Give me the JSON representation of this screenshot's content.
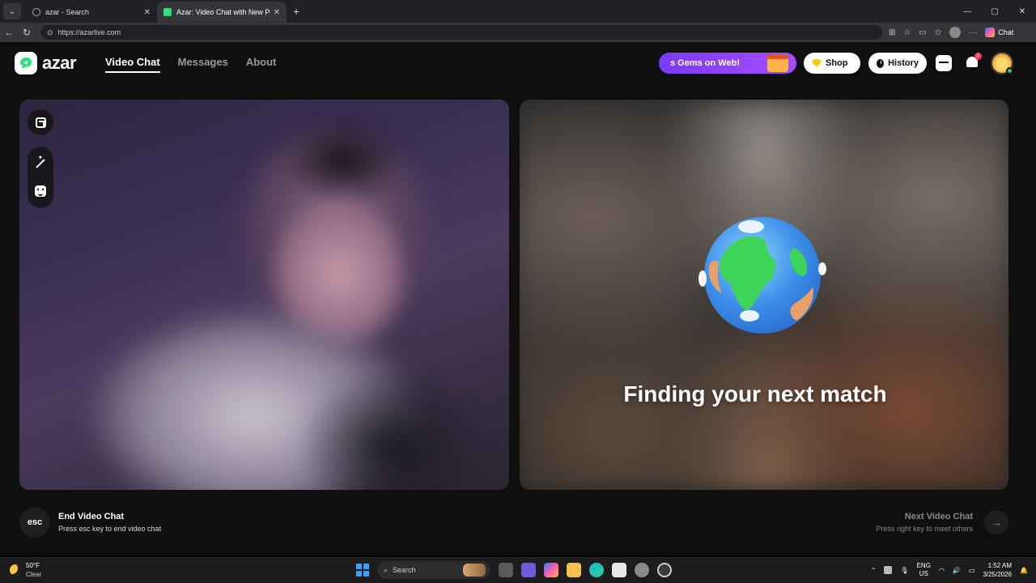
{
  "browser": {
    "tabs": [
      {
        "title": "azar - Search",
        "active": false
      },
      {
        "title": "Azar: Video Chat with New Pe",
        "active": true
      }
    ],
    "url": "https://azarlive.com",
    "chat_label": "Chat",
    "window_controls": {
      "minimize": "—",
      "maximize": "▢",
      "close": "✕"
    }
  },
  "header": {
    "logo_text": "azar",
    "nav": [
      {
        "label": "Video Chat",
        "active": true
      },
      {
        "label": "Messages",
        "active": false
      },
      {
        "label": "About",
        "active": false
      }
    ],
    "promo_label": "s Gems on Web!",
    "shop_label": "Shop",
    "history_label": "History",
    "notification_badge": "1"
  },
  "remote_panel": {
    "status_text": "Finding your next match"
  },
  "footer": {
    "end": {
      "key": "esc",
      "title": "End Video Chat",
      "subtitle": "Press esc key to end video chat"
    },
    "next": {
      "title": "Next Video Chat",
      "subtitle": "Press right key to meet others",
      "arrow": "→"
    }
  },
  "taskbar": {
    "weather_temp": "50°F",
    "weather_desc": "Clear",
    "search_label": "Search",
    "lang_top": "ENG",
    "lang_bottom": "US",
    "time": "1:52 AM",
    "date": "3/25/2026"
  },
  "colors": {
    "accent_purple": "#7b3bff",
    "brand_green": "#2fe07a",
    "badge_red": "#ff3b5c"
  }
}
